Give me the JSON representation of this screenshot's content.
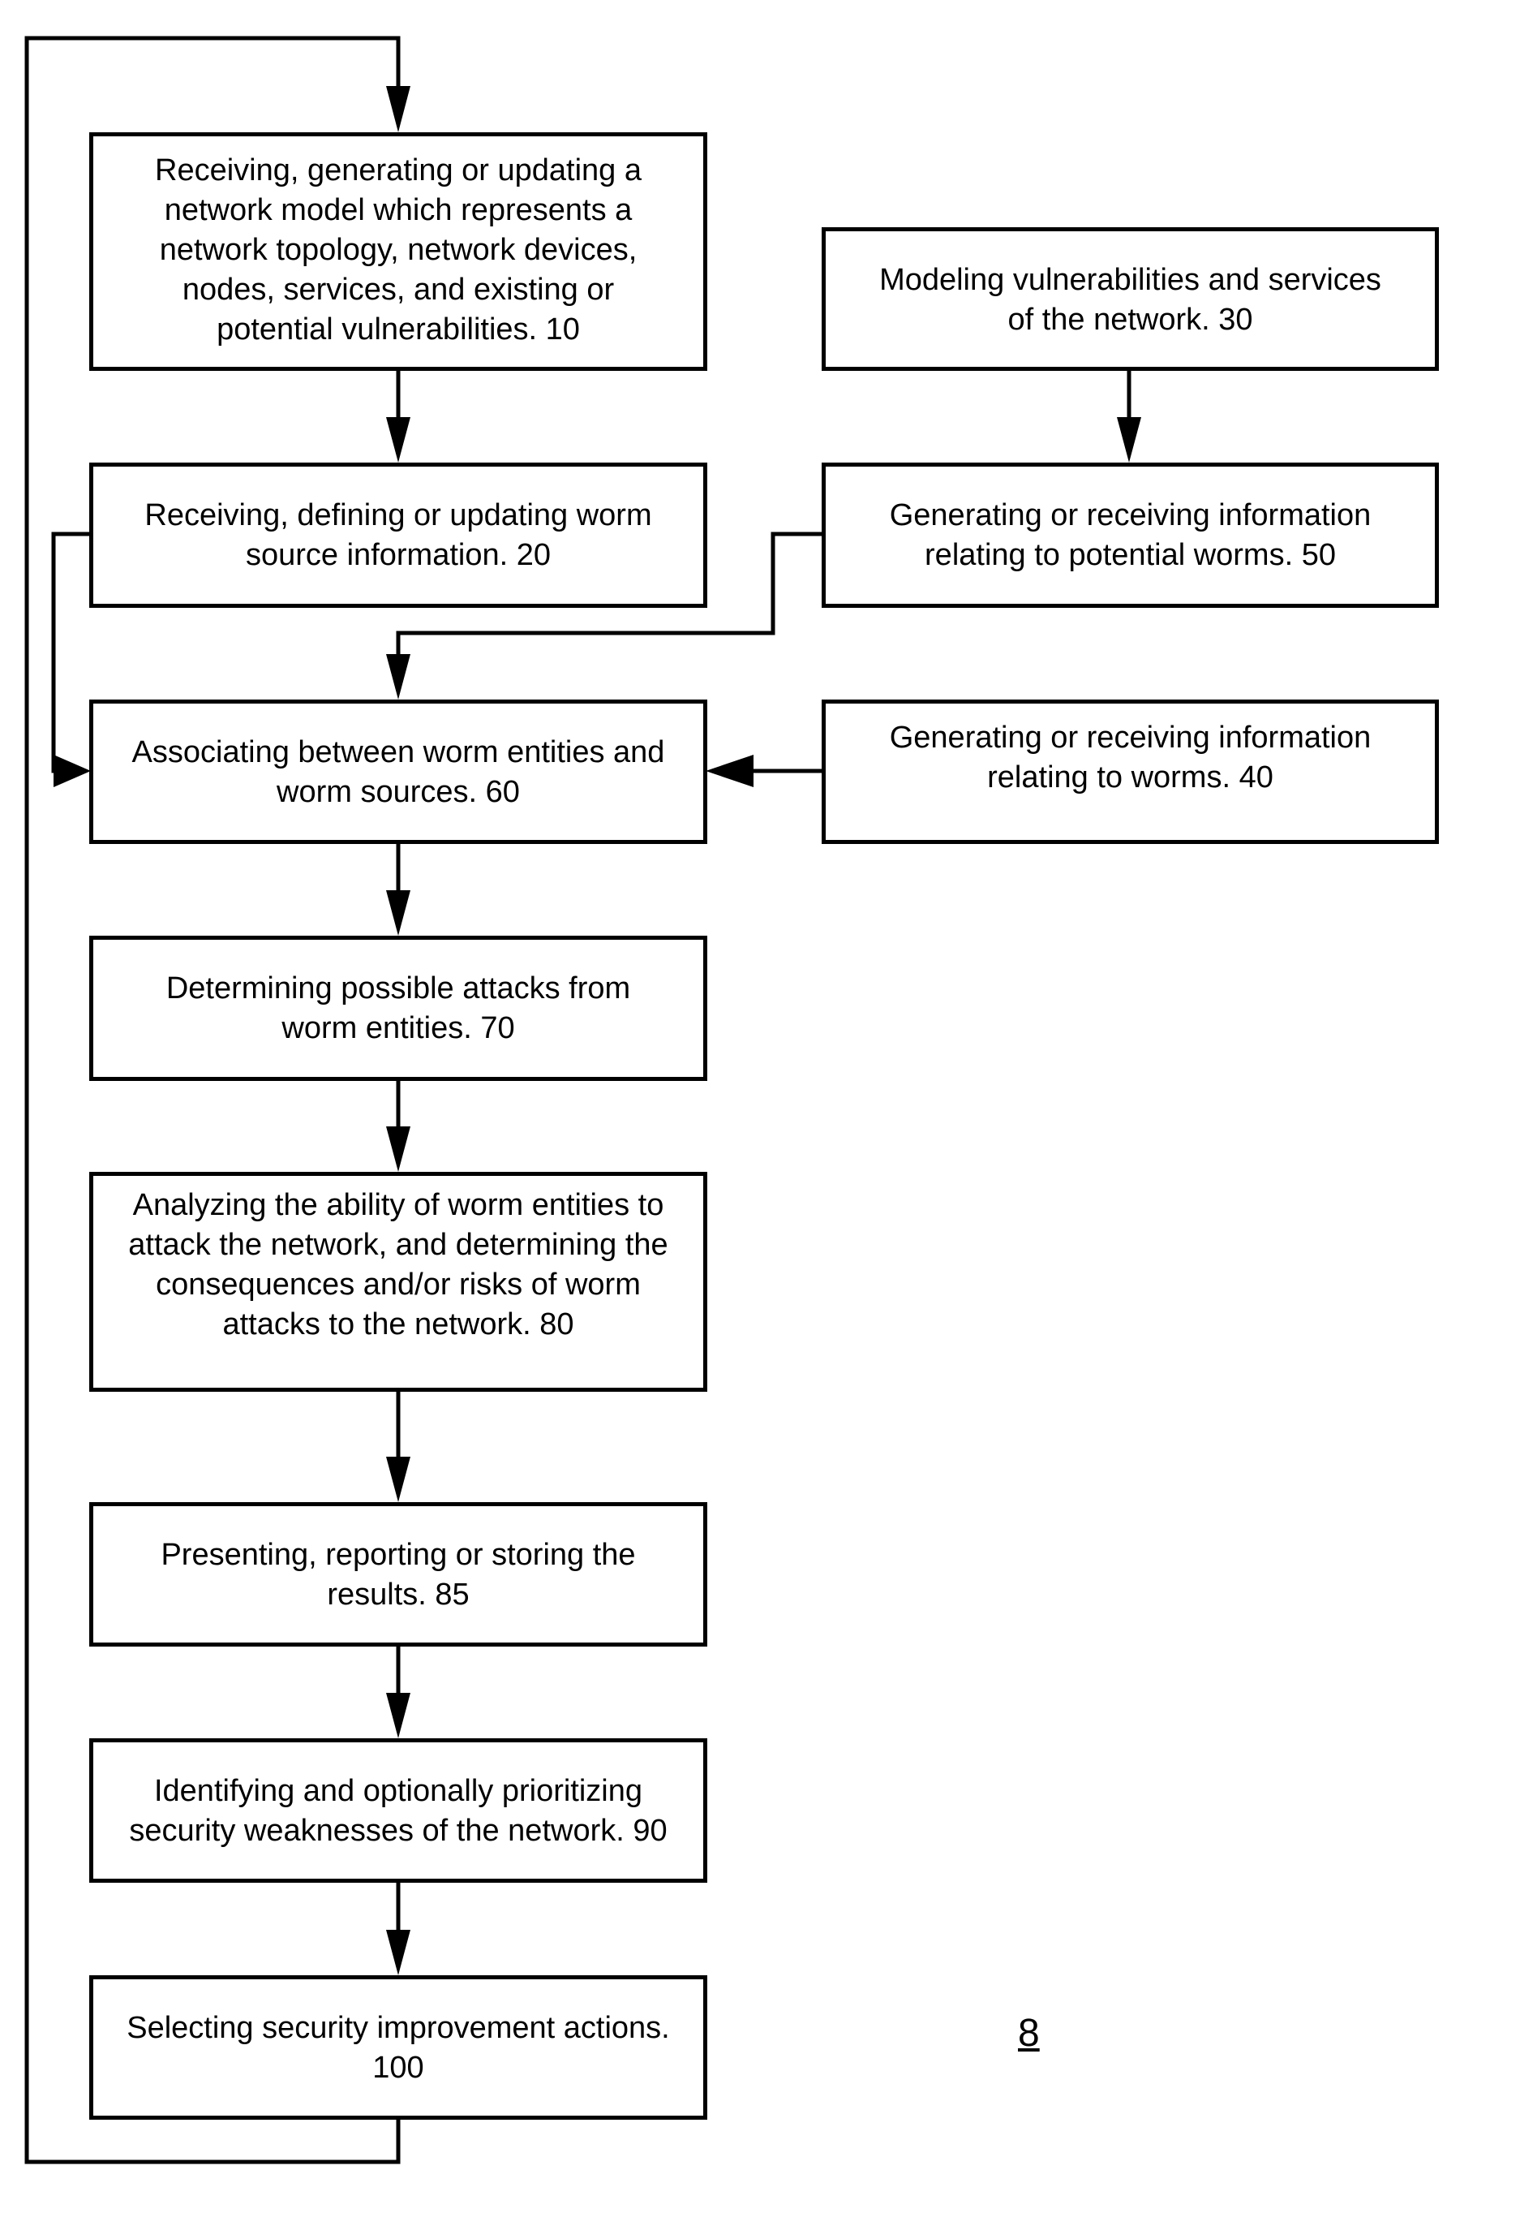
{
  "figure_label": "8",
  "steps": [
    {
      "id": "10",
      "text": "Receiving, generating or updating a\nnetwork model which represents a\nnetwork topology, network devices,\nnodes, services, and existing or\npotential vulnerabilities.   10"
    },
    {
      "id": "30",
      "text": "  Modeling vulnerabilities and services\nof the network.  30"
    },
    {
      "id": "20",
      "text": "Receiving, defining or updating worm\nsource information. 20"
    },
    {
      "id": "50",
      "text": "Generating or receiving information\nrelating to potential worms. 50"
    },
    {
      "id": "60",
      "text": "Associating between worm entities and\nworm sources. 60"
    },
    {
      "id": "40",
      "text": "Generating or receiving information\nrelating to worms. 40"
    },
    {
      "id": "70",
      "text": "Determining possible attacks from\nworm entities. 70"
    },
    {
      "id": "80",
      "text": "Analyzing the ability of worm entities to\nattack the network, and determining the\nconsequences and/or risks of worm\nattacks to the network. 80"
    },
    {
      "id": "85",
      "text": "  Presenting, reporting or storing the\nresults. 85"
    },
    {
      "id": "90",
      "text": "  Identifying and optionally prioritizing\nsecurity weaknesses of the network. 90"
    },
    {
      "id": "100",
      "text": "Selecting security improvement actions.\n100"
    }
  ],
  "connections": [
    {
      "from": "10",
      "to": "20"
    },
    {
      "from": "30",
      "to": "50"
    },
    {
      "from": "20",
      "to": "60"
    },
    {
      "from": "50",
      "to": "60"
    },
    {
      "from": "40",
      "to": "60"
    },
    {
      "from": "60",
      "to": "70"
    },
    {
      "from": "70",
      "to": "80"
    },
    {
      "from": "80",
      "to": "85"
    },
    {
      "from": "85",
      "to": "90"
    },
    {
      "from": "90",
      "to": "100"
    },
    {
      "from": "100",
      "to": "10"
    }
  ]
}
